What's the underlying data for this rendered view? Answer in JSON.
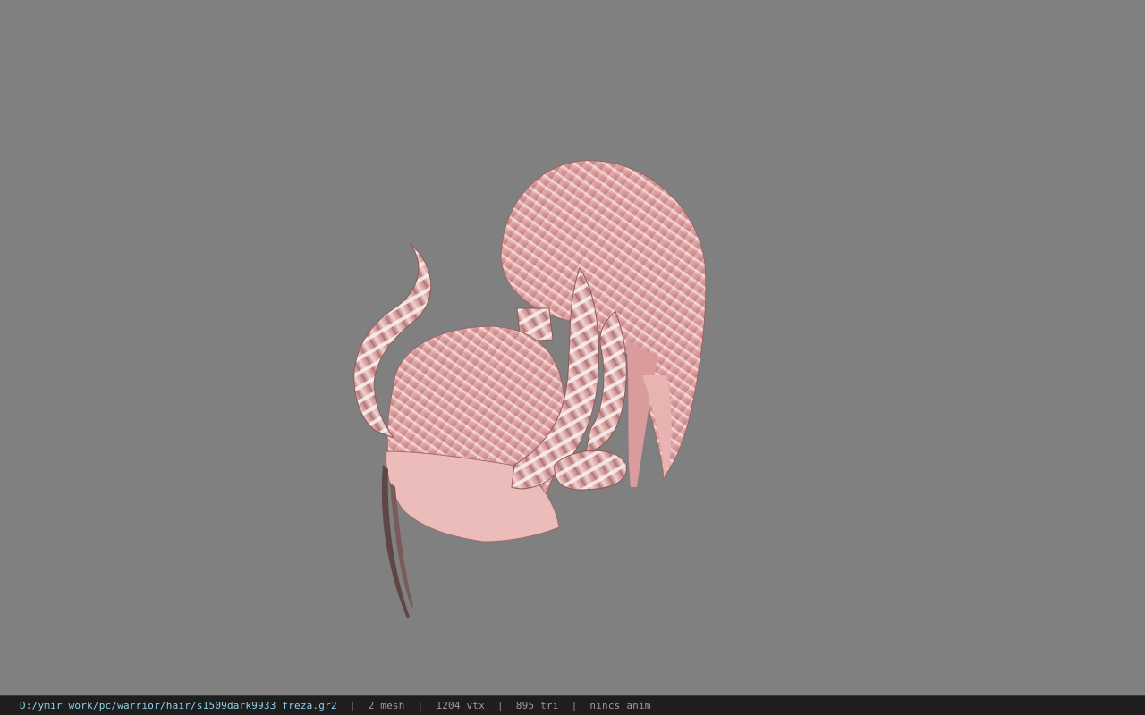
{
  "viewer": {
    "background_color": "#808080",
    "model_icon": "hair-mesh-model",
    "hair_base_color": "#e2a4a4",
    "hair_highlight_color": "#f6e2e0",
    "hair_shadow_color": "#a86c6c"
  },
  "statusbar": {
    "file_path": "D:/ymir work/pc/warrior/hair/s1509dark9933_freza.gr2",
    "separator": "|",
    "mesh_count": "2 mesh",
    "vertex_count": "1204 vtx",
    "triangle_count": "895 tri",
    "anim_status": "nincs anim"
  }
}
